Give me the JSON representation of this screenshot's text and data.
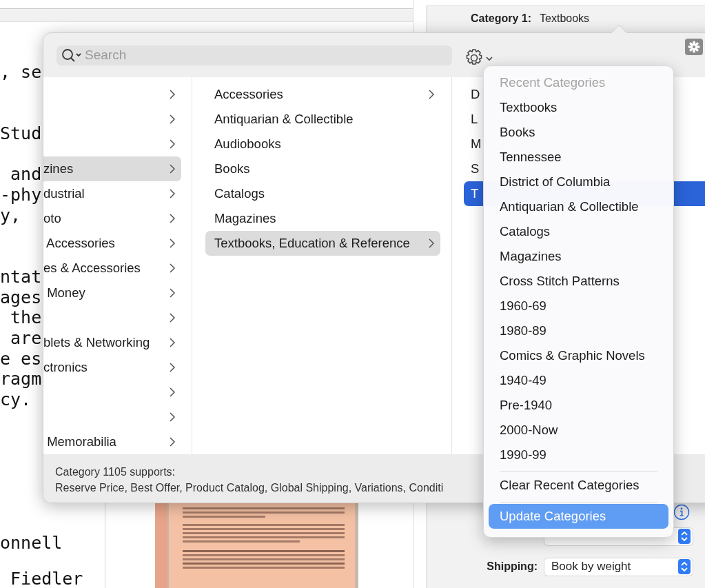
{
  "background": {
    "document_paragraphs": [
      [
        ", se"
      ],
      [
        "Stud"
      ],
      [
        " and",
        "-phy",
        "y,"
      ],
      [
        "ntat",
        "ages",
        " the",
        " are",
        "e es",
        "ragm",
        "cy."
      ],
      [
        "onnell"
      ],
      [
        " Fiedler"
      ]
    ],
    "category": {
      "label": "Category 1:",
      "value": "Textbooks"
    },
    "fields": [
      {
        "kind": "popup"
      },
      {
        "kind": "popup",
        "label": "Shipping:",
        "value": "Book by weight"
      }
    ]
  },
  "popover": {
    "search": {
      "placeholder": "Search"
    },
    "columns": [
      {
        "items": [
          {
            "has_children": true,
            "selected": false
          },
          {
            "has_children": true,
            "selected": false
          },
          {
            "has_children": true,
            "selected": false
          },
          {
            "label": "zines",
            "has_children": true,
            "selected": true
          },
          {
            "label": "dustrial",
            "has_children": true,
            "selected": false
          },
          {
            "label": "oto",
            "has_children": true,
            "selected": false
          },
          {
            "label": " Accessories",
            "has_children": true,
            "selected": false
          },
          {
            "label": "es & Accessories",
            "has_children": true,
            "selected": false
          },
          {
            "label": " Money",
            "has_children": true,
            "selected": false
          },
          {
            "has_children": true,
            "selected": false
          },
          {
            "label": "blets & Networking",
            "has_children": true,
            "selected": false
          },
          {
            "label": "ctronics",
            "has_children": true,
            "selected": false
          },
          {
            "has_children": true,
            "selected": false
          },
          {
            "has_children": true,
            "selected": false
          },
          {
            "label": " Memorabilia",
            "has_children": true,
            "selected": false
          }
        ]
      },
      {
        "items": [
          {
            "label": "Accessories",
            "has_children": true,
            "selected": false
          },
          {
            "label": "Antiquarian & Collectible",
            "has_children": false,
            "selected": false
          },
          {
            "label": "Audiobooks",
            "has_children": false,
            "selected": false
          },
          {
            "label": "Books",
            "has_children": false,
            "selected": false
          },
          {
            "label": "Catalogs",
            "has_children": false,
            "selected": false
          },
          {
            "label": "Magazines",
            "has_children": false,
            "selected": false
          },
          {
            "label": "Textbooks, Education & Reference",
            "has_children": true,
            "selected": true
          }
        ]
      },
      {
        "items": [
          {
            "label": "D",
            "selected": false
          },
          {
            "label": "L",
            "selected": false
          },
          {
            "label": "M",
            "selected": false
          },
          {
            "label": "S",
            "selected": false
          },
          {
            "label": "T",
            "selected": true
          }
        ]
      }
    ],
    "footer": {
      "title": "Category 1105 supports:",
      "features": "Reserve Price, Best Offer, Product Catalog, Global Shipping, Variations, Conditi"
    }
  },
  "menu": {
    "header": "Recent Categories",
    "items": [
      {
        "label": "Textbooks",
        "selected": false
      },
      {
        "label": "Books",
        "selected": false
      },
      {
        "label": "Tennessee",
        "selected": false
      },
      {
        "label": "District of Columbia",
        "selected": false
      },
      {
        "label": "Antiquarian & Collectible",
        "selected": false
      },
      {
        "label": "Catalogs",
        "selected": false
      },
      {
        "label": "Magazines",
        "selected": false
      },
      {
        "label": "Cross Stitch Patterns",
        "selected": false
      },
      {
        "label": "1960-69",
        "selected": false
      },
      {
        "label": "1980-89",
        "selected": false
      },
      {
        "label": "Comics & Graphic Novels",
        "selected": false
      },
      {
        "label": "1940-49",
        "selected": false
      },
      {
        "label": "Pre-1940",
        "selected": false
      },
      {
        "label": "2000-Now",
        "selected": false
      },
      {
        "label": "1990-99",
        "selected": false
      }
    ],
    "actions": [
      {
        "label": "Clear Recent Categories",
        "selected": false
      },
      {
        "label": "Update Categories",
        "selected": true
      }
    ]
  }
}
